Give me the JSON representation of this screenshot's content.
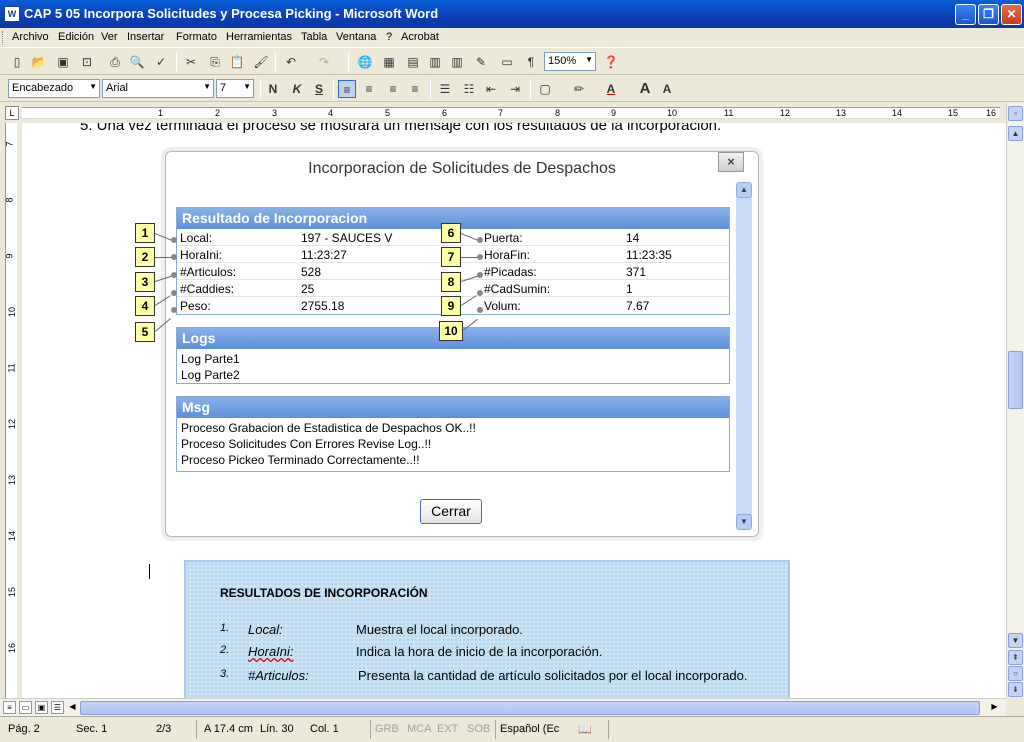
{
  "window": {
    "title": "CAP 5 05 Incorpora Solicitudes y Procesa Picking - Microsoft Word",
    "app_icon": "W"
  },
  "menu": [
    "Archivo",
    "Edición",
    "Ver",
    "Insertar",
    "Formato",
    "Herramientas",
    "Tabla",
    "Ventana",
    "?",
    "Acrobat"
  ],
  "toolbar": {
    "zoom": "150%"
  },
  "format_toolbar": {
    "style": "Encabezado",
    "font": "Arial",
    "size": "7",
    "bold": "N",
    "italic": "K",
    "underline": "S"
  },
  "ruler": {
    "marks": [
      "1",
      "2",
      "3",
      "4",
      "5",
      "6",
      "7",
      "8",
      "9",
      "10",
      "11",
      "12",
      "13",
      "14",
      "15",
      "16"
    ],
    "vmarks": [
      "7",
      "8",
      "9",
      "10",
      "11",
      "12",
      "13",
      "14",
      "15",
      "16"
    ]
  },
  "document": {
    "top_line": "5.    Una vez terminada el proceso se mostrará un mensaje con los resultados de la incorporación."
  },
  "dialog": {
    "title": "Incorporacion de Solicitudes de Despachos",
    "close": "×",
    "results_header": "Resultado de Incorporacion",
    "rows": [
      {
        "l_label": "Local:",
        "l_value": "197 - SAUCES V",
        "r_label": "Puerta:",
        "r_value": "14"
      },
      {
        "l_label": "HoraIni:",
        "l_value": "11:23:27",
        "r_label": "HoraFin:",
        "r_value": "11:23:35"
      },
      {
        "l_label": "#Articulos:",
        "l_value": "528",
        "r_label": "#Picadas:",
        "r_value": "371"
      },
      {
        "l_label": "#Caddies:",
        "l_value": "25",
        "r_label": "#CadSumin:",
        "r_value": "1"
      },
      {
        "l_label": "Peso:",
        "l_value": "2755.18",
        "r_label": "Volum:",
        "r_value": "7.67"
      }
    ],
    "logs_header": "Logs",
    "logs": [
      "Log Parte1",
      "Log Parte2"
    ],
    "msg_header": "Msg",
    "msgs": [
      "Proceso Grabacion de Estadistica de Despachos OK..!!",
      "Proceso Solicitudes Con Errores Revise Log..!!",
      "Proceso Pickeo Terminado Correctamente..!!"
    ],
    "cerrar": "Cerrar"
  },
  "callouts": [
    "1",
    "2",
    "3",
    "4",
    "5",
    "6",
    "7",
    "8",
    "9",
    "10"
  ],
  "textbox": {
    "heading": "RESULTADOS DE INCORPORACIÓN",
    "items": [
      {
        "num": "1.",
        "key": "Local:",
        "desc": "Muestra el local incorporado."
      },
      {
        "num": "2.",
        "key": "HoraIni:",
        "desc": "Indica la hora de inicio de la incorporación."
      },
      {
        "num": "3.",
        "key": "#Articulos:",
        "desc": "Presenta la cantidad de artículo solicitados por el local incorporado."
      }
    ]
  },
  "status": {
    "page": "Pág. 2",
    "section": "Sec. 1",
    "pages": "2/3",
    "position": "A 17.4 cm",
    "line": "Lín. 30",
    "column": "Col. 1",
    "grb": "GRB",
    "mca": "MCA",
    "ext": "EXT",
    "sob": "SOB",
    "language": "Español (Ec"
  }
}
